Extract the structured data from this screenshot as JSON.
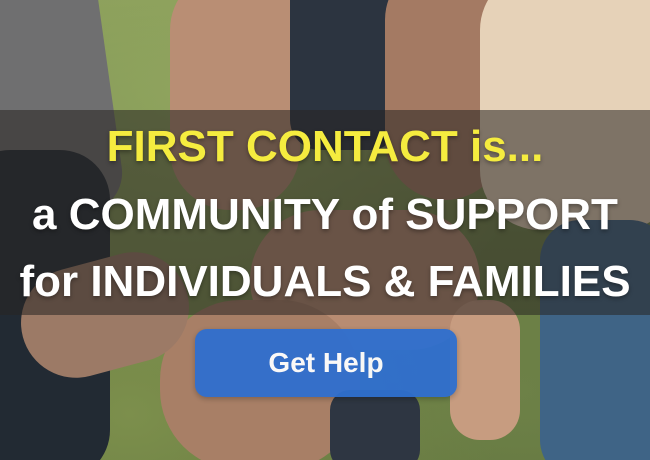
{
  "hero": {
    "headline": "FIRST CONTACT is...",
    "line2": "a COMMUNITY of SUPPORT",
    "line3": "for INDIVIDUALS & FAMILIES"
  },
  "cta": {
    "label": "Get Help"
  },
  "colors": {
    "headline": "#f5ec3f",
    "body_text": "#ffffff",
    "button": "#2f6fcf",
    "overlay_band": "rgba(40,36,34,0.55)"
  }
}
